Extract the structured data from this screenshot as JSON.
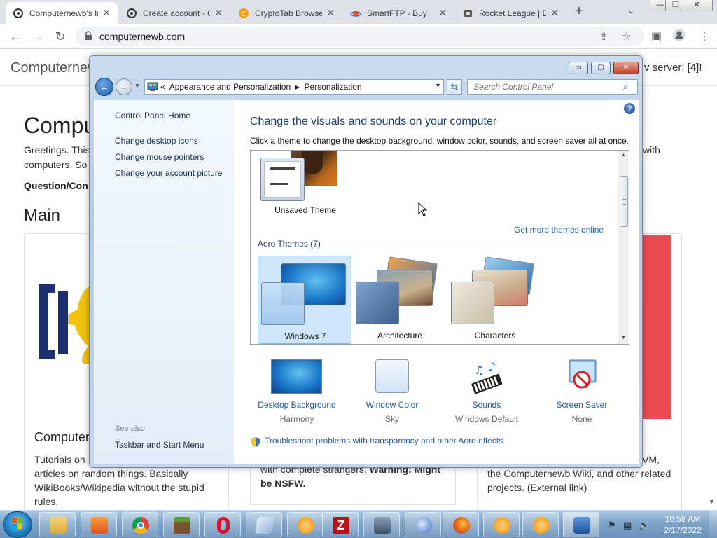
{
  "browser": {
    "tabs": [
      {
        "title": "Computernewb's Ir"
      },
      {
        "title": "Create account - Cc"
      },
      {
        "title": "CryptoTab Browser"
      },
      {
        "title": "SmartFTP - Buy"
      },
      {
        "title": "Rocket League | Dc"
      }
    ],
    "new_tab": "+",
    "url": "computernewb.com"
  },
  "site": {
    "name": "Computernew",
    "header_right": "v server! [4]!",
    "heading": "Compu",
    "greeting_1": "Greetings. This",
    "greeting_2": "computers. So",
    "greeting_right": "with",
    "question": "Question/Con",
    "main": "Main",
    "card1_title": "Computer",
    "card1_text_1": "Tutorials on",
    "card1_text_2": "articles on random things. Basically",
    "card1_text_3": "WikiBooks/Wikipedia without the stupid",
    "card1_text_4": "rules.",
    "card2_text_1": "with complete strangers.",
    "card2_warning": "Warning: Might",
    "card2_text_2": "be NSFW.",
    "card3_text_1": "bVM,",
    "card3_text_2": "the Computernewb Wiki, and other related",
    "card3_text_3": "projects. (External link)"
  },
  "control_panel": {
    "breadcrumb_prefix": "«",
    "breadcrumb_1": "Appearance and Personalization",
    "breadcrumb_sep": "▸",
    "breadcrumb_2": "Personalization",
    "search_placeholder": "Search Control Panel",
    "left_links": {
      "home": "Control Panel Home",
      "desktop_icons": "Change desktop icons",
      "mouse_pointers": "Change mouse pointers",
      "account_picture": "Change your account picture"
    },
    "see_also": "See also",
    "taskbar_link": "Taskbar and Start Menu",
    "title": "Change the visuals and sounds on your computer",
    "description": "Click a theme to change the desktop background, window color, sounds, and screen saver all at once.",
    "unsaved_theme": "Unsaved Theme",
    "get_more": "Get more themes online",
    "aero_label": "Aero Themes (7)",
    "themes": [
      {
        "name": "Windows 7",
        "selected": true
      },
      {
        "name": "Architecture",
        "selected": false
      },
      {
        "name": "Characters",
        "selected": false
      }
    ],
    "settings": {
      "background": {
        "label": "Desktop Background",
        "value": "Harmony"
      },
      "color": {
        "label": "Window Color",
        "value": "Sky"
      },
      "sounds": {
        "label": "Sounds",
        "value": "Windows Default"
      },
      "screensaver": {
        "label": "Screen Saver",
        "value": "None"
      }
    },
    "troubleshoot": "Troubleshoot problems with transparency and other Aero effects"
  },
  "taskbar": {
    "time": "10:58 AM",
    "date": "2/17/2022"
  },
  "colors": {
    "link_blue": "#1e5aa8",
    "title_blue": "#1e3d70",
    "red_block": "#e94b4f"
  },
  "icons": [
    "lock-icon",
    "share-icon",
    "star-icon",
    "sidebar-icon",
    "profile-icon",
    "menu-icon",
    "help-icon",
    "search-icon",
    "shield-icon"
  ]
}
